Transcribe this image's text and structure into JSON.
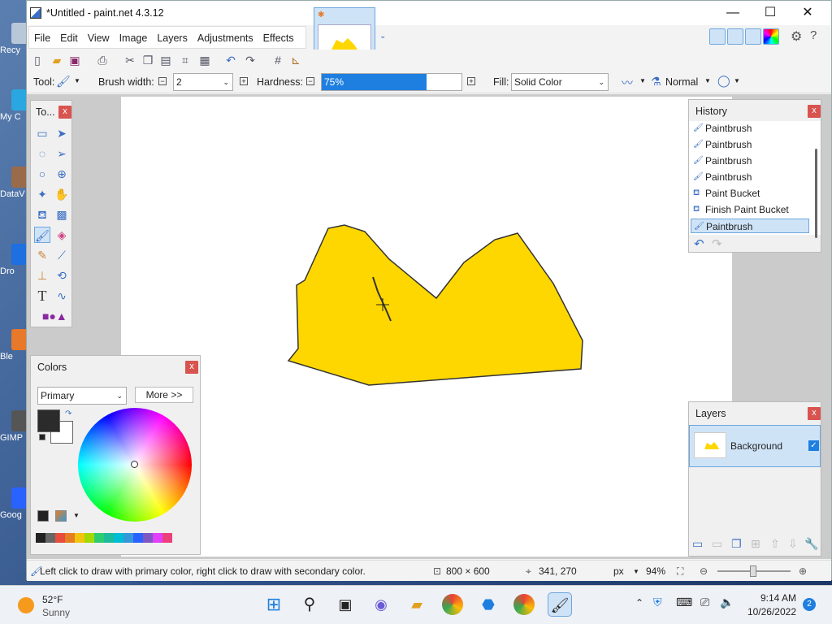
{
  "window": {
    "title": "*Untitled - paint.net 4.3.12",
    "minimize": "—",
    "maximize": "☐",
    "close": "✕"
  },
  "menu": [
    "File",
    "Edit",
    "View",
    "Image",
    "Layers",
    "Adjustments",
    "Effects"
  ],
  "toolbar": {
    "tool_label": "Tool:",
    "brush_width_label": "Brush width:",
    "brush_width_value": "2",
    "hardness_label": "Hardness:",
    "hardness_value": "75%",
    "hardness_fraction": 0.75,
    "fill_label": "Fill:",
    "fill_value": "Solid Color",
    "blend_mode": "Normal"
  },
  "tools_panel": {
    "title": "To...",
    "close": "x"
  },
  "history_panel": {
    "title": "History",
    "close": "x",
    "items": [
      "Paintbrush",
      "Paintbrush",
      "Paintbrush",
      "Paintbrush",
      "Paint Bucket",
      "Finish Paint Bucket",
      "Paintbrush"
    ],
    "selected_index": 6
  },
  "colors_panel": {
    "title": "Colors",
    "close": "x",
    "mode": "Primary",
    "more_button": "More >>",
    "primary_color": "#2b2b2b",
    "secondary_color": "#ffffff"
  },
  "layers_panel": {
    "title": "Layers",
    "close": "x",
    "layer_name": "Background"
  },
  "canvas": {
    "fill_color": "#ffd700",
    "outline_color": "#333333"
  },
  "statusbar": {
    "hint": "Left click to draw with primary color, right click to draw with secondary color.",
    "image_size": "800 × 600",
    "cursor_pos": "341, 270",
    "units": "px",
    "zoom": "94%"
  },
  "taskbar": {
    "weather_temp": "52°F",
    "weather_desc": "Sunny",
    "time": "9:14 AM",
    "date": "10/26/2022",
    "notification_count": "2"
  },
  "desktop_icons": [
    "Recy",
    "My C",
    "DataV",
    "Dro",
    "Ble",
    "GIMP",
    "Goog"
  ],
  "palette_colors": [
    "#222",
    "#666",
    "#e74c3c",
    "#e67e22",
    "#f1c40f",
    "#a3d900",
    "#2ecc71",
    "#1abc9c",
    "#00bcd4",
    "#3498db",
    "#2962ff",
    "#7e57c2",
    "#e040fb",
    "#ec407a"
  ]
}
